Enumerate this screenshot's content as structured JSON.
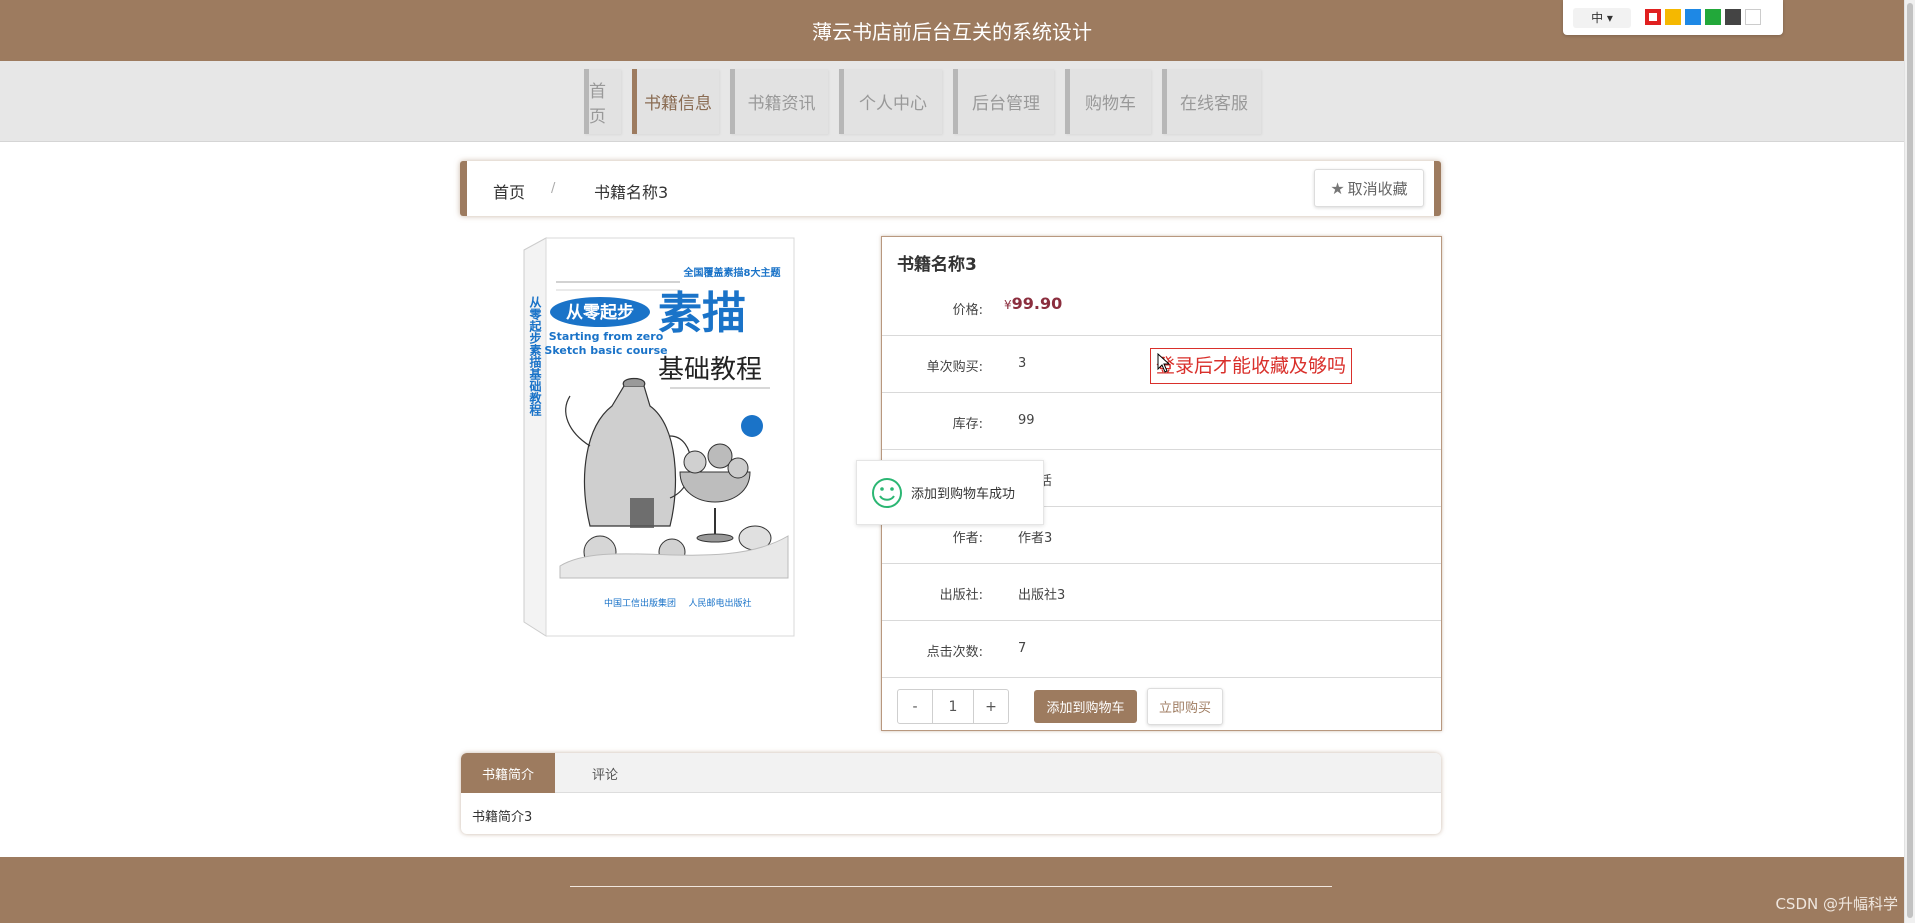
{
  "header": {
    "title": "薄云书店前后台互关的系统设计",
    "lang": "中",
    "theme_colors": [
      "#e02020",
      "#f5b800",
      "#1e88e5",
      "#22a83a",
      "#444444",
      "#ffffff"
    ]
  },
  "nav": {
    "items": [
      {
        "label": "首页",
        "active": false
      },
      {
        "label": "书籍信息",
        "active": true
      },
      {
        "label": "书籍资讯",
        "active": false
      },
      {
        "label": "个人中心",
        "active": false
      },
      {
        "label": "后台管理",
        "active": false
      },
      {
        "label": "购物车",
        "active": false
      },
      {
        "label": "在线客服",
        "active": false
      }
    ]
  },
  "breadcrumb": {
    "home": "首页",
    "separator": "/",
    "current": "书籍名称3",
    "favorite_button": "取消收藏"
  },
  "cover": {
    "badge": "全国覆盖素描8大主题",
    "title_part1": "从零起步",
    "title_big": "素描",
    "subtitle": "基础教程",
    "english_line1": "Starting from zero",
    "english_line2": "Sketch basic course",
    "spine": "从零起步素描基础教程"
  },
  "book": {
    "title": "书籍名称3",
    "price_label": "价格:",
    "currency": "¥",
    "price": "99.90",
    "single_limit_label": "单次购买:",
    "single_limit": "3",
    "stock_label": "库存:",
    "stock": "99",
    "category_value": "生活",
    "author_label": "作者:",
    "author": "作者3",
    "publisher_label": "出版社:",
    "publisher": "出版社3",
    "clicks_label": "点击次数:",
    "clicks": "7",
    "warning": "登录后才能收藏及够吗"
  },
  "cart": {
    "minus": "-",
    "quantity": "1",
    "plus": "+",
    "add_to_cart": "添加到购物车",
    "buy_now": "立即购买"
  },
  "toast": {
    "message": "添加到购物车成功"
  },
  "tabs": {
    "intro": "书籍简介",
    "comments": "评论",
    "content": "书籍简介3"
  },
  "watermark": "CSDN @升幅科学"
}
